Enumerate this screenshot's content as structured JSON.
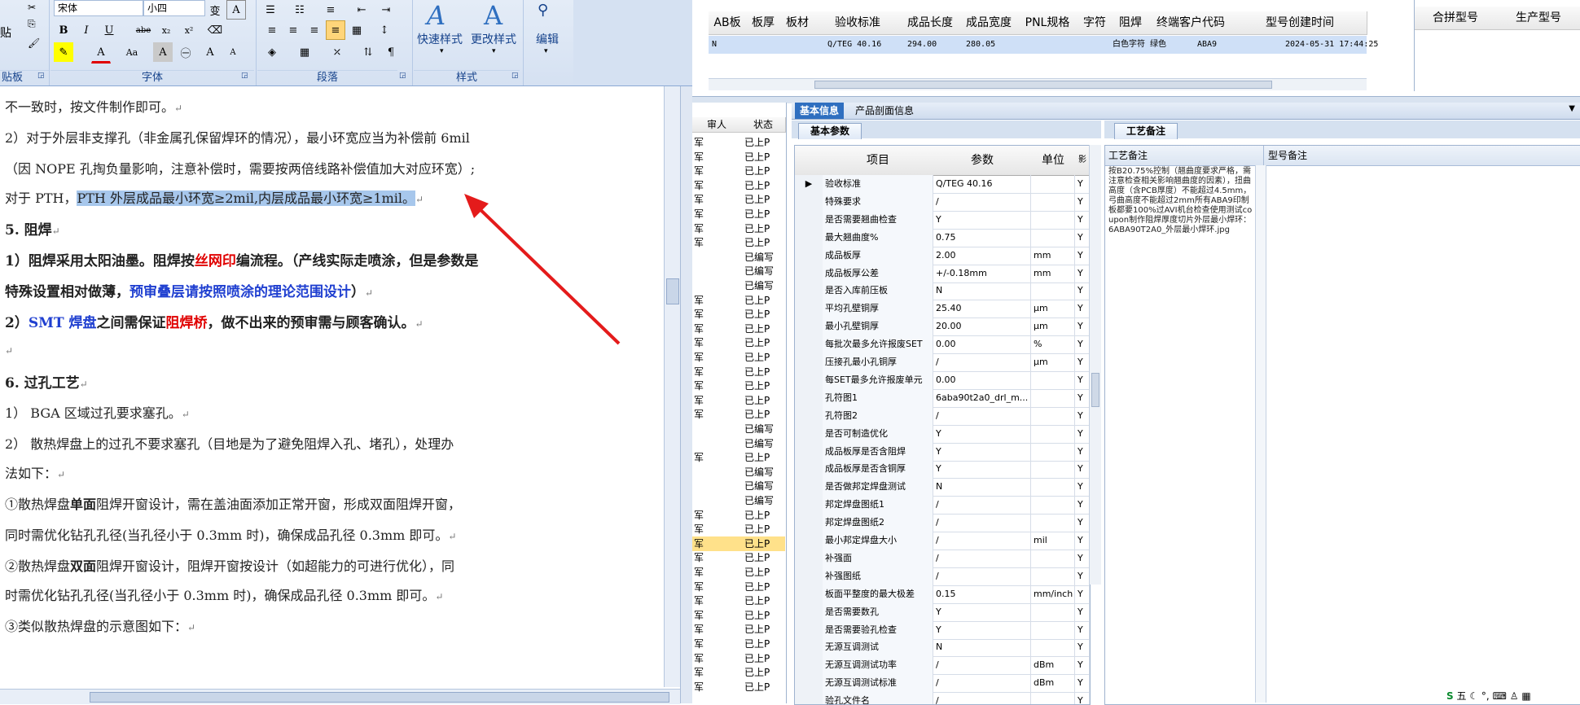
{
  "ribbon": {
    "font_name": "宋体",
    "font_size": "小四",
    "clipboard_label": "贴板",
    "paste_label": "贴",
    "font_group_label": "字体",
    "paragraph_group_label": "段落",
    "style_group_label": "样式",
    "quick_style_label": "快速样式",
    "change_style_label": "更改样式",
    "edit_label": "编辑",
    "text_sample_label": "A",
    "bold": "B",
    "italic": "I",
    "underline": "U",
    "strike": "abe",
    "subscript": "x₂",
    "superscript": "x²",
    "font_color_btn": "A",
    "case_btn": "Aa",
    "char_border_btn": "A",
    "enclose_btn": "㊀",
    "grow_btn": "A",
    "shrink_btn": "A"
  },
  "document": {
    "lines": [
      {
        "t": "不一致时，按文件制作即可。"
      },
      {
        "t": "2）对于外层非支撑孔（非金属孔保留焊环的情况），最小环宽应当为补偿前 6mil"
      },
      {
        "t": "（因 NOPE 孔掏负量影响，注意补偿时，需要按两倍线路补偿值加大对应环宽）;"
      },
      {
        "a": "对于 PTH，",
        "hl": "PTH 外层成品最小环宽≥2mil,内层成品最小环宽≥1mil。"
      },
      {
        "b": "5. 阻焊"
      },
      {
        "a": "1）阻焊采用太阳油墨。阻焊按",
        "r": "丝网印",
        "c": "编流程。（产线实际走喷涂，但是参数是"
      },
      {
        "b": "特殊设置相对做薄，",
        "bl": "预审叠层请按照喷涂的理论范围设计",
        "c": "）"
      },
      {
        "a": "2）",
        "bl": "SMT 焊盘",
        "c": "之间需保证",
        "r": "阻焊桥",
        "d": "，做不出来的预审需与顾客确认。"
      },
      {
        "t": ""
      },
      {
        "b": "6. 过孔工艺"
      },
      {
        "t": "1） BGA 区域过孔要求塞孔。"
      },
      {
        "t": "2） 散热焊盘上的过孔不要求塞孔（目地是为了避免阻焊入孔、堵孔），处理办"
      },
      {
        "t": "法如下："
      },
      {
        "a": "①散热焊盘",
        "b": "单面",
        "c": "阻焊开窗设计，需在盖油面添加正常开窗，形成双面阻焊开窗，"
      },
      {
        "t": "同时需优化钻孔孔径(当孔径小于 0.3mm 时)，确保成品孔径 0.3mm 即可。"
      },
      {
        "a": "②散热焊盘",
        "b": "双面",
        "c": "阻焊开窗设计，阻焊开窗按设计（如超能力的可进行优化），同"
      },
      {
        "t": "时需优化钻孔孔径(当孔径小于 0.3mm 时)，确保成品孔径 0.3mm 即可。"
      },
      {
        "t": "③类似散热焊盘的示意图如下："
      }
    ],
    "para_mark": "↵"
  },
  "top_grid": {
    "headers": [
      "AB板",
      "板厚",
      "板材",
      "验收标准",
      "成品长度",
      "成品宽度",
      "PNL规格",
      "字符",
      "阻焊",
      "终端客户代码",
      "型号创建时间"
    ],
    "row": [
      "N",
      "",
      "",
      "Q/TEG 40.16",
      "294.00",
      "280.05",
      "",
      "白色字符",
      "绿色",
      "ABA9",
      "2024-05-31 17:44:25"
    ],
    "extra_headers": [
      "合拼型号",
      "生产型号"
    ]
  },
  "left_list": {
    "headers": [
      "审人",
      "状态"
    ],
    "rows": [
      [
        "军",
        "已上P"
      ],
      [
        "军",
        "已上P"
      ],
      [
        "军",
        "已上P"
      ],
      [
        "军",
        "已上P"
      ],
      [
        "军",
        "已上P"
      ],
      [
        "军",
        "已上P"
      ],
      [
        "军",
        "已上P"
      ],
      [
        "军",
        "已上P"
      ],
      [
        "",
        "已编写"
      ],
      [
        "",
        "已编写"
      ],
      [
        "",
        "已编写"
      ],
      [
        "军",
        "已上P"
      ],
      [
        "军",
        "已上P"
      ],
      [
        "军",
        "已上P"
      ],
      [
        "军",
        "已上P"
      ],
      [
        "军",
        "已上P"
      ],
      [
        "军",
        "已上P"
      ],
      [
        "军",
        "已上P"
      ],
      [
        "军",
        "已上P"
      ],
      [
        "军",
        "已上P"
      ],
      [
        "",
        "已编写"
      ],
      [
        "",
        "已编写"
      ],
      [
        "军",
        "已上P"
      ],
      [
        "",
        "已编写"
      ],
      [
        "",
        "已编写"
      ],
      [
        "",
        "已编写"
      ],
      [
        "军",
        "已上P"
      ],
      [
        "军",
        "已上P"
      ],
      [
        "军",
        "已上P"
      ],
      [
        "军",
        "已上P"
      ],
      [
        "军",
        "已上P"
      ],
      [
        "军",
        "已上P"
      ],
      [
        "军",
        "已上P"
      ],
      [
        "军",
        "已上P"
      ],
      [
        "军",
        "已上P"
      ],
      [
        "军",
        "已上P"
      ],
      [
        "军",
        "已上P"
      ],
      [
        "军",
        "已上P"
      ],
      [
        "军",
        "已上P"
      ]
    ],
    "selected_index": 28
  },
  "tabs": [
    "基本信息",
    "产品剖面信息"
  ],
  "subtabs": {
    "left": "基本参数",
    "right": "工艺备注"
  },
  "param_table": {
    "headers": [
      "项目",
      "参数",
      "单位",
      "影"
    ],
    "rows": [
      [
        "验收标准",
        "Q/TEG 40.16",
        "",
        "Y"
      ],
      [
        "特殊要求",
        "/",
        "",
        "Y"
      ],
      [
        "是否需要翘曲检查",
        "Y",
        "",
        "Y"
      ],
      [
        "最大翘曲度%",
        "0.75",
        "",
        "Y"
      ],
      [
        "成品板厚",
        "2.00",
        "mm",
        "Y"
      ],
      [
        "成品板厚公差",
        "+/-0.18mm",
        "mm",
        "Y"
      ],
      [
        "是否入库前压板",
        "N",
        "",
        "Y"
      ],
      [
        "平均孔壁铜厚",
        "25.40",
        "μm",
        "Y"
      ],
      [
        "最小孔壁铜厚",
        "20.00",
        "μm",
        "Y"
      ],
      [
        "每批次最多允许报废SET",
        "0.00",
        "%",
        "Y"
      ],
      [
        "压接孔最小孔铜厚",
        "/",
        "μm",
        "Y"
      ],
      [
        "每SET最多允许报废单元",
        "0.00",
        "",
        "Y"
      ],
      [
        "孔符图1",
        "6aba90t2a0_drl_m...",
        "",
        "Y"
      ],
      [
        "孔符图2",
        "/",
        "",
        "Y"
      ],
      [
        "是否可制造优化",
        "Y",
        "",
        "Y"
      ],
      [
        "成品板厚是否含阻焊",
        "Y",
        "",
        "Y"
      ],
      [
        "成品板厚是否含铜厚",
        "Y",
        "",
        "Y"
      ],
      [
        "是否做邦定焊盘测试",
        "N",
        "",
        "Y"
      ],
      [
        "邦定焊盘图纸1",
        "/",
        "",
        "Y"
      ],
      [
        "邦定焊盘图纸2",
        "/",
        "",
        "Y"
      ],
      [
        "最小邦定焊盘大小",
        "/",
        "mil",
        "Y"
      ],
      [
        "补强面",
        "/",
        "",
        "Y"
      ],
      [
        "补强图纸",
        "/",
        "",
        "Y"
      ],
      [
        "板面平整度的最大极差",
        "0.15",
        "mm/inch",
        "Y"
      ],
      [
        "是否需要数孔",
        "Y",
        "",
        "Y"
      ],
      [
        "是否需要验孔检查",
        "Y",
        "",
        "Y"
      ],
      [
        "无源互调测试",
        "N",
        "",
        "Y"
      ],
      [
        "无源互调测试功率",
        "/",
        "dBm",
        "Y"
      ],
      [
        "无源互调测试标准",
        "/",
        "dBm",
        "Y"
      ],
      [
        "验孔文件名",
        "/",
        "",
        "Y"
      ]
    ]
  },
  "remark_panel": {
    "col1": "工艺备注",
    "col2": "型号备注",
    "text": "按B20.75%控制（翘曲度要求严格，需注意检查相关影响翘曲度的因素），扭曲高度（含PCB厚度）不能超过4.5mm，弓曲高度不能超过2mm所有ABA9印制板都要100%过AVI机台检查使用测试coupon制作阻焊厚度切片外层最小焊环：6ABA90T2A0_外层最小焊环.jpg"
  },
  "taskbar": {
    "ime": "五"
  }
}
